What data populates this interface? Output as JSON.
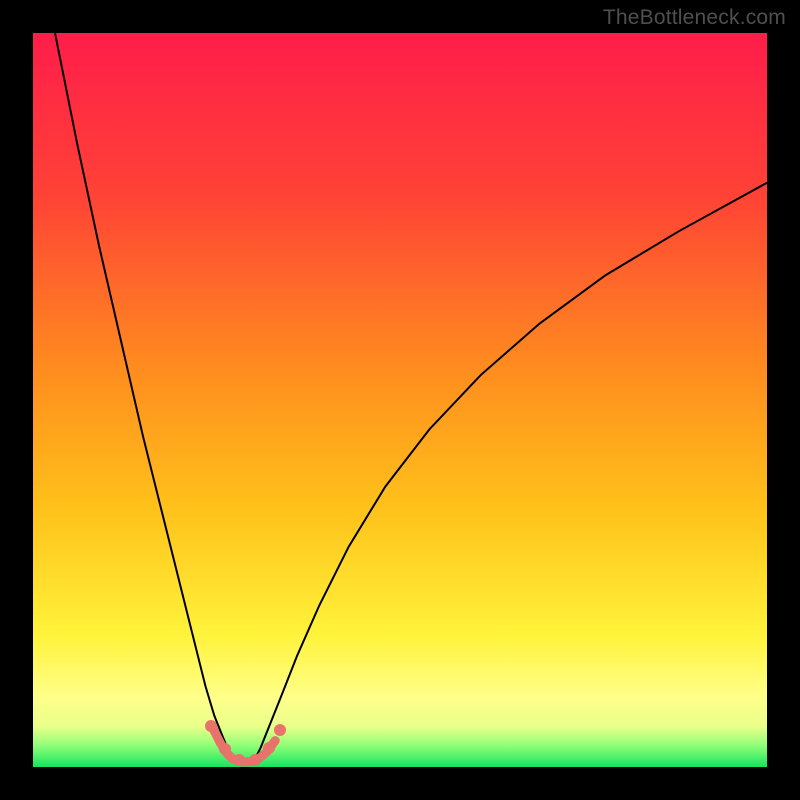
{
  "watermark": {
    "text": "TheBottleneck.com"
  },
  "chart_data": {
    "type": "line",
    "title": "",
    "xlabel": "",
    "ylabel": "",
    "xlim": [
      0,
      100
    ],
    "ylim": [
      0,
      100
    ],
    "grid": false,
    "legend": false,
    "background_gradient": {
      "stops": [
        {
          "offset": 0.0,
          "color": "#ff1d4a"
        },
        {
          "offset": 0.22,
          "color": "#ff4236"
        },
        {
          "offset": 0.45,
          "color": "#ff8a1f"
        },
        {
          "offset": 0.65,
          "color": "#ffc21a"
        },
        {
          "offset": 0.82,
          "color": "#fff33a"
        },
        {
          "offset": 0.905,
          "color": "#ffff8a"
        },
        {
          "offset": 0.945,
          "color": "#e9ff8a"
        },
        {
          "offset": 0.97,
          "color": "#93ff78"
        },
        {
          "offset": 1.0,
          "color": "#16e55f"
        }
      ]
    },
    "series": [
      {
        "name": "left-branch",
        "x": [
          3.0,
          6.0,
          9.0,
          12.0,
          15.0,
          18.0,
          20.0,
          22.0,
          23.5,
          24.7,
          25.7,
          26.4,
          27.0,
          27.6
        ],
        "y": [
          100.0,
          85.0,
          71.0,
          58.0,
          45.0,
          33.0,
          25.0,
          17.0,
          11.0,
          7.0,
          4.5,
          2.8,
          1.6,
          0.6
        ],
        "stroke": "#000000",
        "width": 2
      },
      {
        "name": "right-branch",
        "x": [
          30.0,
          31.0,
          32.2,
          33.8,
          36.0,
          39.0,
          43.0,
          48.0,
          54.0,
          61.0,
          69.0,
          78.0,
          88.0,
          100.0
        ],
        "y": [
          0.6,
          2.6,
          5.6,
          9.6,
          15.2,
          22.0,
          30.0,
          38.2,
          46.0,
          53.4,
          60.4,
          67.0,
          73.0,
          79.6
        ],
        "stroke": "#000000",
        "width": 2
      },
      {
        "name": "valley-floor",
        "x": [
          24.5,
          25.5,
          26.3,
          27.2,
          28.3,
          29.5,
          30.7,
          31.8,
          33.0
        ],
        "y": [
          5.3,
          3.3,
          2.0,
          1.1,
          0.7,
          0.7,
          1.1,
          2.0,
          3.6
        ],
        "stroke": "#e8736b",
        "width": 9,
        "linecap": "round"
      }
    ],
    "markers": [
      {
        "x": 24.3,
        "y": 5.6
      },
      {
        "x": 26.2,
        "y": 2.4
      },
      {
        "x": 28.1,
        "y": 0.9
      },
      {
        "x": 30.3,
        "y": 0.9
      },
      {
        "x": 32.1,
        "y": 2.6
      },
      {
        "x": 33.6,
        "y": 5.0
      }
    ],
    "marker_color": "#e8736b",
    "marker_radius_px": 6
  }
}
